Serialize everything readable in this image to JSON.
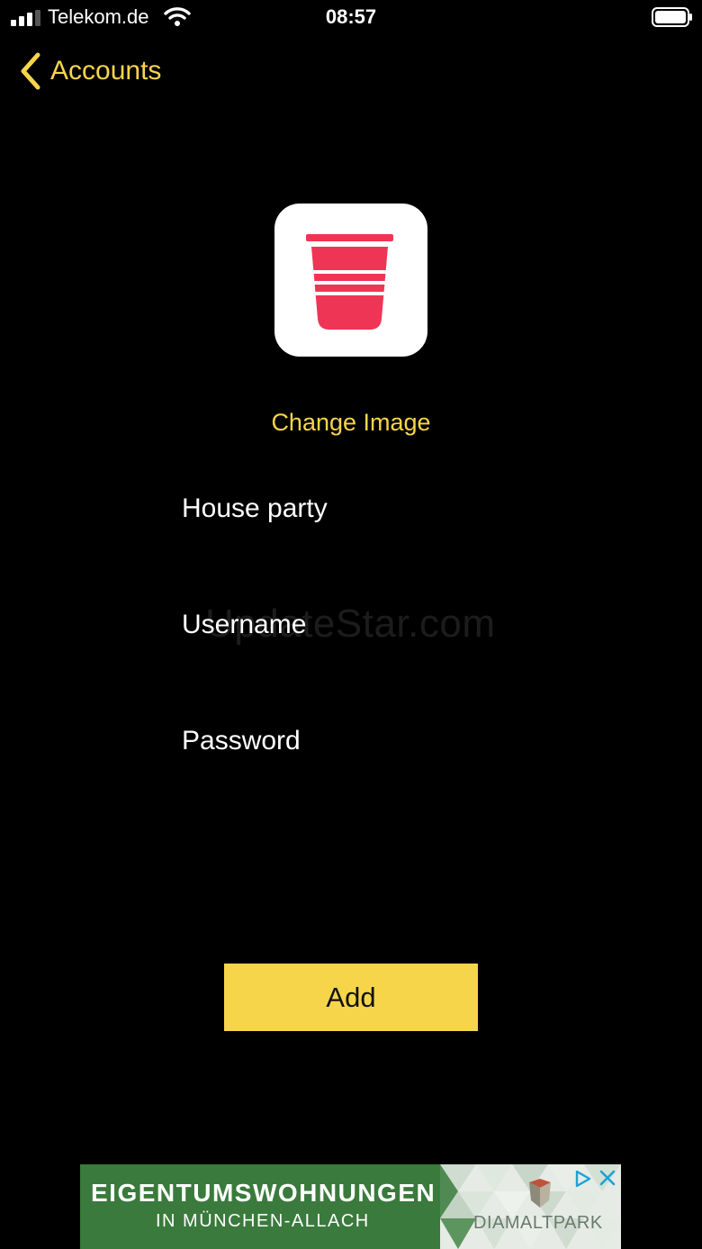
{
  "status_bar": {
    "carrier": "Telekom.de",
    "time": "08:57"
  },
  "nav": {
    "back_label": "Accounts"
  },
  "form": {
    "change_image_label": "Change Image",
    "name_value": "House party",
    "username_placeholder": "Username",
    "password_placeholder": "Password",
    "add_label": "Add"
  },
  "watermark": "UpdateStar.com",
  "ad": {
    "headline": "EIGENTUMSWOHNUNGEN",
    "subline": "IN MÜNCHEN-ALLACH",
    "brand": "DIAMALTPARK"
  },
  "colors": {
    "accent": "#f7d54a",
    "cup": "#ee3556",
    "ad_green": "#3a7a3c"
  },
  "icons": {
    "back": "chevron-left-icon",
    "app_image": "party-cup-icon"
  }
}
